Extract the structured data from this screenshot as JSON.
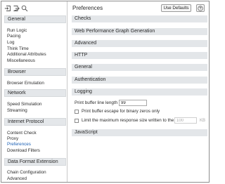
{
  "sidebar": {
    "sections": [
      {
        "title": "General",
        "items": [
          "Run Logic",
          "Pacing",
          "Log",
          "Think Time",
          "Additional Attributes",
          "Miscellaneous"
        ]
      },
      {
        "title": "Browser",
        "items": [
          "Browser Emulation"
        ]
      },
      {
        "title": "Network",
        "items": [
          "Speed Simulation",
          "Streaming"
        ]
      },
      {
        "title": "Internet Protocol",
        "items": [
          "Content Check",
          "Proxy",
          "Preferences",
          "Download Filters"
        ]
      },
      {
        "title": "Data Format Extension",
        "items": [
          "Chain Configuration",
          "Advanced"
        ]
      }
    ],
    "active_item": "Preferences"
  },
  "panel": {
    "title": "Preferences",
    "use_defaults_label": "Use Defaults",
    "help_icon": "question-icon",
    "groups": [
      "Checks",
      "Web Performance Graph Generation",
      "Advanced",
      "HTTP",
      "General",
      "Authentication",
      "Logging",
      "JavaScript"
    ],
    "logging": {
      "buffer_label": "Print buffer line length",
      "buffer_value": "99",
      "escape_label": "Print buffer escape for binary zeros only",
      "escape_checked": false,
      "limit_label": "Limit the maximum response size written to the log",
      "limit_checked": false,
      "limit_value": "100",
      "limit_unit": "KB"
    }
  },
  "colors": {
    "active_link": "#1a5fb4",
    "section_header_bg": "#e4e7ea"
  }
}
